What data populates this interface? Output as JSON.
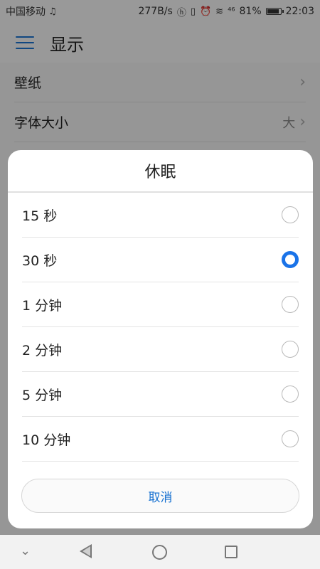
{
  "status_bar": {
    "carrier": "中国移动",
    "net_speed": "277B/s",
    "signal": "⁴⁶",
    "battery_text": "81%",
    "battery_level": 0.81,
    "time": "22:03"
  },
  "header": {
    "title": "显示"
  },
  "settings": {
    "items": [
      {
        "label": "壁纸",
        "value": ""
      },
      {
        "label": "字体大小",
        "value": "大"
      }
    ]
  },
  "dialog": {
    "title": "休眠",
    "options": [
      {
        "label": "15 秒",
        "selected": false
      },
      {
        "label": "30 秒",
        "selected": true
      },
      {
        "label": "1 分钟",
        "selected": false
      },
      {
        "label": "2 分钟",
        "selected": false
      },
      {
        "label": "5 分钟",
        "selected": false
      },
      {
        "label": "10 分钟",
        "selected": false
      }
    ],
    "cancel_label": "取消"
  },
  "colors": {
    "accent": "#1a73e8"
  }
}
